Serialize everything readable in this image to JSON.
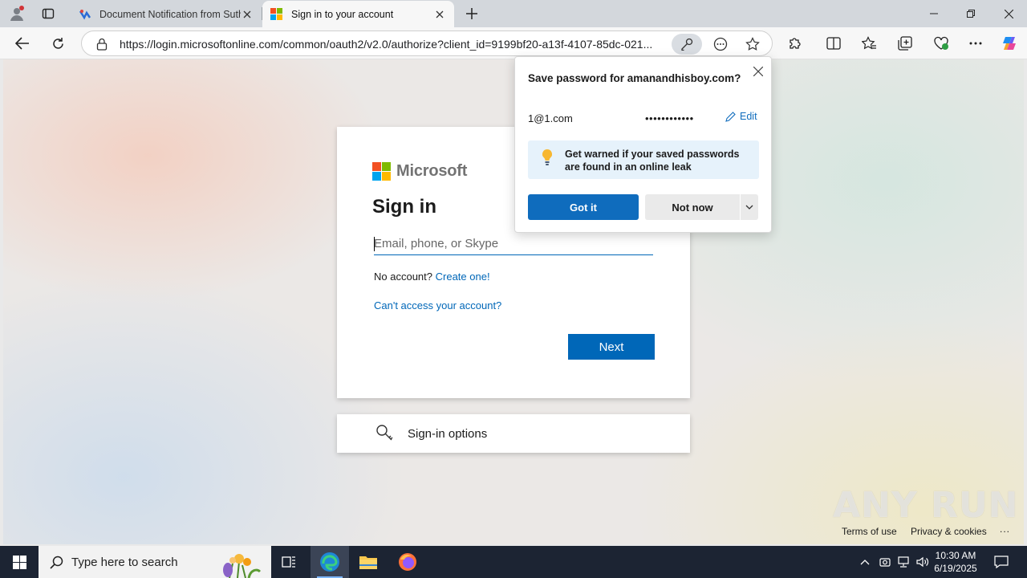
{
  "tabs": [
    {
      "title": "Document Notification from Suth",
      "active": false
    },
    {
      "title": "Sign in to your account",
      "active": true
    }
  ],
  "address_bar": {
    "url": "https://login.microsoftonline.com/common/oauth2/v2.0/authorize?client_id=9199bf20-a13f-4107-85dc-021..."
  },
  "signin": {
    "brand": "Microsoft",
    "title": "Sign in",
    "email_placeholder": "Email, phone, or Skype",
    "no_account": "No account?",
    "create_link": "Create one!",
    "cant_access": "Can't access your account?",
    "next_label": "Next",
    "options_label": "Sign-in options",
    "logo_colors": [
      "#f25022",
      "#7fba00",
      "#00a4ef",
      "#ffb900"
    ]
  },
  "footer": {
    "terms": "Terms of use",
    "privacy": "Privacy & cookies",
    "more": "..."
  },
  "watermark": "ANY RUN",
  "password_popup": {
    "title": "Save password for amanandhisboy.com?",
    "username": "1@1.com",
    "password_mask": "••••••••••••",
    "edit_label": "Edit",
    "info_text": "Get warned if your saved passwords are found in an online leak",
    "gotit_label": "Got it",
    "notnow_label": "Not now"
  },
  "taskbar": {
    "search_placeholder": "Type here to search",
    "time": "10:30 AM",
    "date": "6/19/2025"
  },
  "colors": {
    "accent": "#0067b8",
    "edge_blue": "#0f6cbd",
    "taskbar": "#1c2433"
  }
}
